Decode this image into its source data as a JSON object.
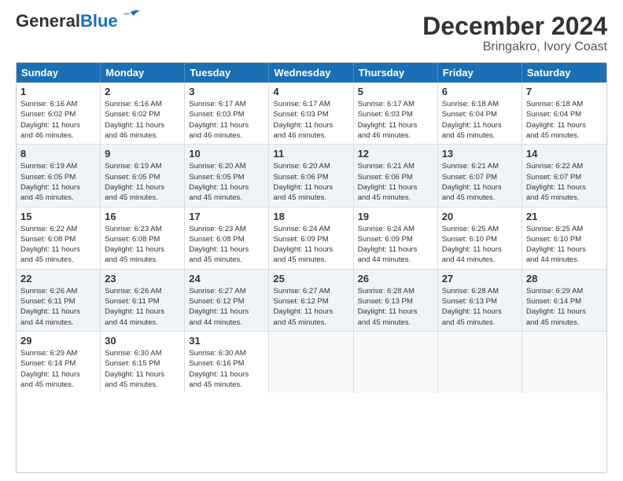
{
  "logo": {
    "text_general": "General",
    "text_blue": "Blue"
  },
  "title": "December 2024",
  "subtitle": "Bringakro, Ivory Coast",
  "days": [
    "Sunday",
    "Monday",
    "Tuesday",
    "Wednesday",
    "Thursday",
    "Friday",
    "Saturday"
  ],
  "rows": [
    [
      {
        "day": "1",
        "info": "Sunrise: 6:16 AM\nSunset: 6:02 PM\nDaylight: 11 hours\nand 46 minutes."
      },
      {
        "day": "2",
        "info": "Sunrise: 6:16 AM\nSunset: 6:02 PM\nDaylight: 11 hours\nand 46 minutes."
      },
      {
        "day": "3",
        "info": "Sunrise: 6:17 AM\nSunset: 6:03 PM\nDaylight: 11 hours\nand 46 minutes."
      },
      {
        "day": "4",
        "info": "Sunrise: 6:17 AM\nSunset: 6:03 PM\nDaylight: 11 hours\nand 46 minutes."
      },
      {
        "day": "5",
        "info": "Sunrise: 6:17 AM\nSunset: 6:03 PM\nDaylight: 11 hours\nand 46 minutes."
      },
      {
        "day": "6",
        "info": "Sunrise: 6:18 AM\nSunset: 6:04 PM\nDaylight: 11 hours\nand 45 minutes."
      },
      {
        "day": "7",
        "info": "Sunrise: 6:18 AM\nSunset: 6:04 PM\nDaylight: 11 hours\nand 45 minutes."
      }
    ],
    [
      {
        "day": "8",
        "info": "Sunrise: 6:19 AM\nSunset: 6:05 PM\nDaylight: 11 hours\nand 45 minutes."
      },
      {
        "day": "9",
        "info": "Sunrise: 6:19 AM\nSunset: 6:05 PM\nDaylight: 11 hours\nand 45 minutes."
      },
      {
        "day": "10",
        "info": "Sunrise: 6:20 AM\nSunset: 6:05 PM\nDaylight: 11 hours\nand 45 minutes."
      },
      {
        "day": "11",
        "info": "Sunrise: 6:20 AM\nSunset: 6:06 PM\nDaylight: 11 hours\nand 45 minutes."
      },
      {
        "day": "12",
        "info": "Sunrise: 6:21 AM\nSunset: 6:06 PM\nDaylight: 11 hours\nand 45 minutes."
      },
      {
        "day": "13",
        "info": "Sunrise: 6:21 AM\nSunset: 6:07 PM\nDaylight: 11 hours\nand 45 minutes."
      },
      {
        "day": "14",
        "info": "Sunrise: 6:22 AM\nSunset: 6:07 PM\nDaylight: 11 hours\nand 45 minutes."
      }
    ],
    [
      {
        "day": "15",
        "info": "Sunrise: 6:22 AM\nSunset: 6:08 PM\nDaylight: 11 hours\nand 45 minutes."
      },
      {
        "day": "16",
        "info": "Sunrise: 6:23 AM\nSunset: 6:08 PM\nDaylight: 11 hours\nand 45 minutes."
      },
      {
        "day": "17",
        "info": "Sunrise: 6:23 AM\nSunset: 6:08 PM\nDaylight: 11 hours\nand 45 minutes."
      },
      {
        "day": "18",
        "info": "Sunrise: 6:24 AM\nSunset: 6:09 PM\nDaylight: 11 hours\nand 45 minutes."
      },
      {
        "day": "19",
        "info": "Sunrise: 6:24 AM\nSunset: 6:09 PM\nDaylight: 11 hours\nand 44 minutes."
      },
      {
        "day": "20",
        "info": "Sunrise: 6:25 AM\nSunset: 6:10 PM\nDaylight: 11 hours\nand 44 minutes."
      },
      {
        "day": "21",
        "info": "Sunrise: 6:25 AM\nSunset: 6:10 PM\nDaylight: 11 hours\nand 44 minutes."
      }
    ],
    [
      {
        "day": "22",
        "info": "Sunrise: 6:26 AM\nSunset: 6:11 PM\nDaylight: 11 hours\nand 44 minutes."
      },
      {
        "day": "23",
        "info": "Sunrise: 6:26 AM\nSunset: 6:11 PM\nDaylight: 11 hours\nand 44 minutes."
      },
      {
        "day": "24",
        "info": "Sunrise: 6:27 AM\nSunset: 6:12 PM\nDaylight: 11 hours\nand 44 minutes."
      },
      {
        "day": "25",
        "info": "Sunrise: 6:27 AM\nSunset: 6:12 PM\nDaylight: 11 hours\nand 45 minutes."
      },
      {
        "day": "26",
        "info": "Sunrise: 6:28 AM\nSunset: 6:13 PM\nDaylight: 11 hours\nand 45 minutes."
      },
      {
        "day": "27",
        "info": "Sunrise: 6:28 AM\nSunset: 6:13 PM\nDaylight: 11 hours\nand 45 minutes."
      },
      {
        "day": "28",
        "info": "Sunrise: 6:29 AM\nSunset: 6:14 PM\nDaylight: 11 hours\nand 45 minutes."
      }
    ],
    [
      {
        "day": "29",
        "info": "Sunrise: 6:29 AM\nSunset: 6:14 PM\nDaylight: 11 hours\nand 45 minutes."
      },
      {
        "day": "30",
        "info": "Sunrise: 6:30 AM\nSunset: 6:15 PM\nDaylight: 11 hours\nand 45 minutes."
      },
      {
        "day": "31",
        "info": "Sunrise: 6:30 AM\nSunset: 6:16 PM\nDaylight: 11 hours\nand 45 minutes."
      },
      {
        "day": "",
        "info": ""
      },
      {
        "day": "",
        "info": ""
      },
      {
        "day": "",
        "info": ""
      },
      {
        "day": "",
        "info": ""
      }
    ]
  ]
}
